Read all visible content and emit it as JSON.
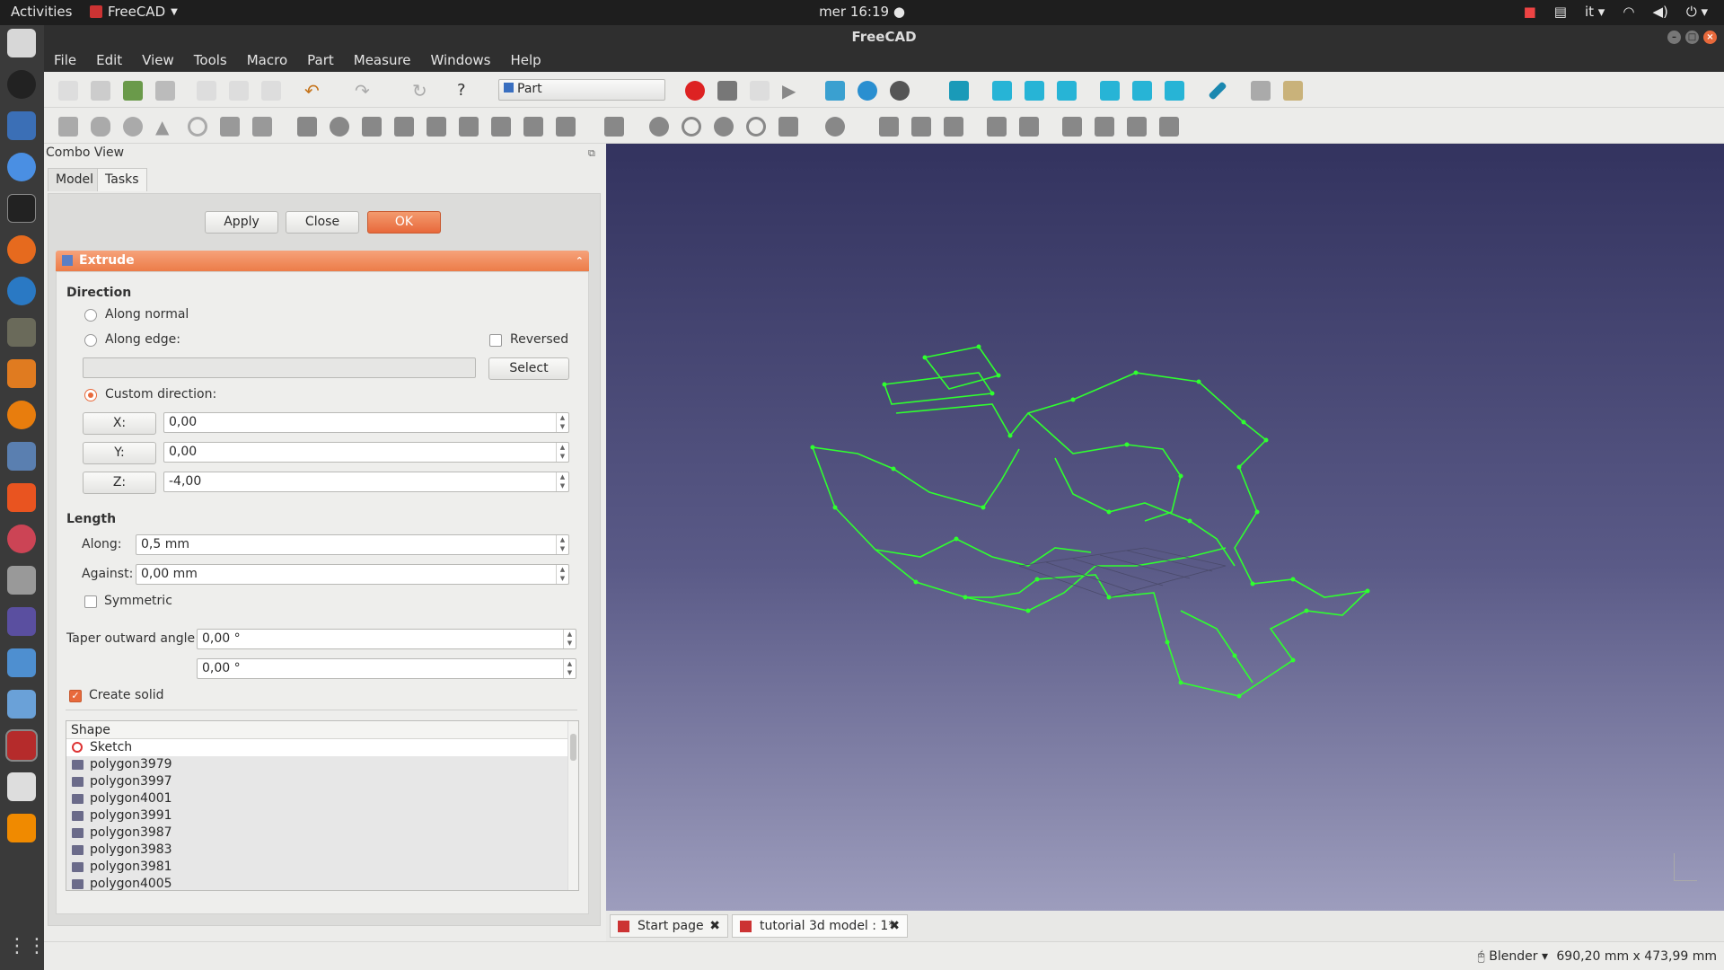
{
  "system": {
    "activities": "Activities",
    "app_menu": "FreeCAD",
    "clock": "mer 16:19",
    "language": "it"
  },
  "window": {
    "title": "FreeCAD"
  },
  "menu": [
    "File",
    "Edit",
    "View",
    "Tools",
    "Macro",
    "Part",
    "Measure",
    "Windows",
    "Help"
  ],
  "workbench": {
    "selected": "Part"
  },
  "combo": {
    "title": "Combo View",
    "tabs": [
      "Model",
      "Tasks"
    ],
    "buttons": {
      "apply": "Apply",
      "close": "Close",
      "ok": "OK"
    }
  },
  "extrude": {
    "title": "Extrude",
    "direction_label": "Direction",
    "along_normal": "Along normal",
    "along_edge": "Along edge:",
    "reversed": "Reversed",
    "select": "Select",
    "custom_direction": "Custom direction:",
    "x_label": "X:",
    "y_label": "Y:",
    "z_label": "Z:",
    "x_value": "0,00",
    "y_value": "0,00",
    "z_value": "-4,00",
    "length_label": "Length",
    "along_label": "Along:",
    "along_value": "0,5 mm",
    "against_label": "Against:",
    "against_value": "0,00 mm",
    "symmetric": "Symmetric",
    "taper_label": "Taper outward angle",
    "taper_value": "0,00 °",
    "taper_value2": "0,00 °",
    "create_solid": "Create solid",
    "shape_header": "Shape",
    "shapes": [
      "Sketch",
      "polygon3979",
      "polygon3997",
      "polygon4001",
      "polygon3991",
      "polygon3987",
      "polygon3983",
      "polygon3981",
      "polygon4005"
    ]
  },
  "doc_tabs": [
    "Start page",
    "tutorial 3d model : 1*"
  ],
  "status": {
    "navigation": "Blender",
    "dimensions": "690,20 mm x 473,99 mm"
  },
  "colors": {
    "accent": "#e8693b",
    "wireframe": "#33ff33",
    "viewport_top": "#33335f",
    "viewport_bottom": "#9d9dbd"
  }
}
